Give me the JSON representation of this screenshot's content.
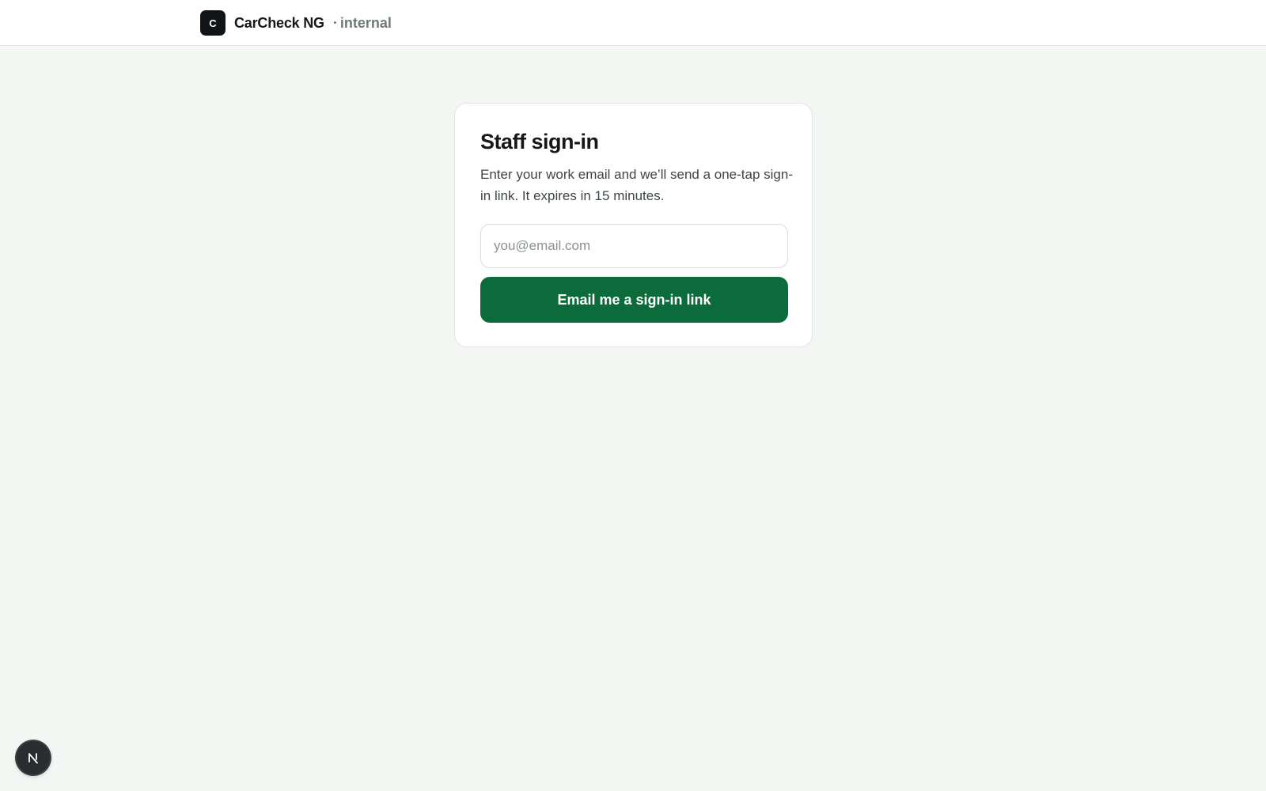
{
  "header": {
    "logo_letter": "C",
    "brand_name": "CarCheck NG",
    "separator": "·",
    "tag": "internal"
  },
  "signin": {
    "title": "Staff sign-in",
    "description": "Enter your work email and we’ll send a one-tap sign-in link. It expires in 15 minutes.",
    "email_placeholder": "you@email.com",
    "email_value": "",
    "submit_label": "Email me a sign-in link"
  },
  "dev_indicator": {
    "icon": "nextjs-n-icon"
  },
  "colors": {
    "primary": "#0b6b3a",
    "background": "#f3f6f3",
    "logo_bg": "#111416"
  }
}
